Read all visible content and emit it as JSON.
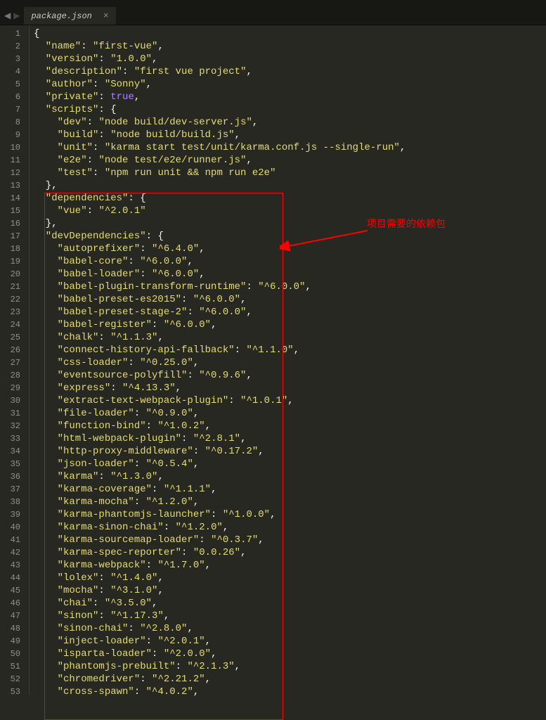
{
  "tab": {
    "name": "package.json",
    "close": "×"
  },
  "nav": {
    "left": "◀",
    "right": "▶"
  },
  "annotation": {
    "text": "项目需要的依赖包"
  },
  "code_lines": [
    [
      [
        "p",
        "{"
      ]
    ],
    [
      [
        "k",
        "  \"name\""
      ],
      [
        "p",
        ": "
      ],
      [
        "s",
        "\"first-vue\""
      ],
      [
        "p",
        ","
      ]
    ],
    [
      [
        "k",
        "  \"version\""
      ],
      [
        "p",
        ": "
      ],
      [
        "s",
        "\"1.0.0\""
      ],
      [
        "p",
        ","
      ]
    ],
    [
      [
        "k",
        "  \"description\""
      ],
      [
        "p",
        ": "
      ],
      [
        "s",
        "\"first vue project\""
      ],
      [
        "p",
        ","
      ]
    ],
    [
      [
        "k",
        "  \"author\""
      ],
      [
        "p",
        ": "
      ],
      [
        "s",
        "\"Sonny\""
      ],
      [
        "p",
        ","
      ]
    ],
    [
      [
        "k",
        "  \"private\""
      ],
      [
        "p",
        ": "
      ],
      [
        "kw",
        "true"
      ],
      [
        "p",
        ","
      ]
    ],
    [
      [
        "k",
        "  \"scripts\""
      ],
      [
        "p",
        ": {"
      ]
    ],
    [
      [
        "k",
        "    \"dev\""
      ],
      [
        "p",
        ": "
      ],
      [
        "s",
        "\"node build/dev-server.js\""
      ],
      [
        "p",
        ","
      ]
    ],
    [
      [
        "k",
        "    \"build\""
      ],
      [
        "p",
        ": "
      ],
      [
        "s",
        "\"node build/build.js\""
      ],
      [
        "p",
        ","
      ]
    ],
    [
      [
        "k",
        "    \"unit\""
      ],
      [
        "p",
        ": "
      ],
      [
        "s",
        "\"karma start test/unit/karma.conf.js --single-run\""
      ],
      [
        "p",
        ","
      ]
    ],
    [
      [
        "k",
        "    \"e2e\""
      ],
      [
        "p",
        ": "
      ],
      [
        "s",
        "\"node test/e2e/runner.js\""
      ],
      [
        "p",
        ","
      ]
    ],
    [
      [
        "k",
        "    \"test\""
      ],
      [
        "p",
        ": "
      ],
      [
        "s",
        "\"npm run unit && npm run e2e\""
      ]
    ],
    [
      [
        "p",
        "  },"
      ]
    ],
    [
      [
        "k",
        "  \"dependencies\""
      ],
      [
        "p",
        ": {"
      ]
    ],
    [
      [
        "k",
        "    \"vue\""
      ],
      [
        "p",
        ": "
      ],
      [
        "s",
        "\"^2.0.1\""
      ]
    ],
    [
      [
        "p",
        "  },"
      ]
    ],
    [
      [
        "k",
        "  \"devDependencies\""
      ],
      [
        "p",
        ": {"
      ]
    ],
    [
      [
        "k",
        "    \"autoprefixer\""
      ],
      [
        "p",
        ": "
      ],
      [
        "s",
        "\"^6.4.0\""
      ],
      [
        "p",
        ","
      ]
    ],
    [
      [
        "k",
        "    \"babel-core\""
      ],
      [
        "p",
        ": "
      ],
      [
        "s",
        "\"^6.0.0\""
      ],
      [
        "p",
        ","
      ]
    ],
    [
      [
        "k",
        "    \"babel-loader\""
      ],
      [
        "p",
        ": "
      ],
      [
        "s",
        "\"^6.0.0\""
      ],
      [
        "p",
        ","
      ]
    ],
    [
      [
        "k",
        "    \"babel-plugin-transform-runtime\""
      ],
      [
        "p",
        ": "
      ],
      [
        "s",
        "\"^6.0.0\""
      ],
      [
        "p",
        ","
      ]
    ],
    [
      [
        "k",
        "    \"babel-preset-es2015\""
      ],
      [
        "p",
        ": "
      ],
      [
        "s",
        "\"^6.0.0\""
      ],
      [
        "p",
        ","
      ]
    ],
    [
      [
        "k",
        "    \"babel-preset-stage-2\""
      ],
      [
        "p",
        ": "
      ],
      [
        "s",
        "\"^6.0.0\""
      ],
      [
        "p",
        ","
      ]
    ],
    [
      [
        "k",
        "    \"babel-register\""
      ],
      [
        "p",
        ": "
      ],
      [
        "s",
        "\"^6.0.0\""
      ],
      [
        "p",
        ","
      ]
    ],
    [
      [
        "k",
        "    \"chalk\""
      ],
      [
        "p",
        ": "
      ],
      [
        "s",
        "\"^1.1.3\""
      ],
      [
        "p",
        ","
      ]
    ],
    [
      [
        "k",
        "    \"connect-history-api-fallback\""
      ],
      [
        "p",
        ": "
      ],
      [
        "s",
        "\"^1.1.0\""
      ],
      [
        "p",
        ","
      ]
    ],
    [
      [
        "k",
        "    \"css-loader\""
      ],
      [
        "p",
        ": "
      ],
      [
        "s",
        "\"^0.25.0\""
      ],
      [
        "p",
        ","
      ]
    ],
    [
      [
        "k",
        "    \"eventsource-polyfill\""
      ],
      [
        "p",
        ": "
      ],
      [
        "s",
        "\"^0.9.6\""
      ],
      [
        "p",
        ","
      ]
    ],
    [
      [
        "k",
        "    \"express\""
      ],
      [
        "p",
        ": "
      ],
      [
        "s",
        "\"^4.13.3\""
      ],
      [
        "p",
        ","
      ]
    ],
    [
      [
        "k",
        "    \"extract-text-webpack-plugin\""
      ],
      [
        "p",
        ": "
      ],
      [
        "s",
        "\"^1.0.1\""
      ],
      [
        "p",
        ","
      ]
    ],
    [
      [
        "k",
        "    \"file-loader\""
      ],
      [
        "p",
        ": "
      ],
      [
        "s",
        "\"^0.9.0\""
      ],
      [
        "p",
        ","
      ]
    ],
    [
      [
        "k",
        "    \"function-bind\""
      ],
      [
        "p",
        ": "
      ],
      [
        "s",
        "\"^1.0.2\""
      ],
      [
        "p",
        ","
      ]
    ],
    [
      [
        "k",
        "    \"html-webpack-plugin\""
      ],
      [
        "p",
        ": "
      ],
      [
        "s",
        "\"^2.8.1\""
      ],
      [
        "p",
        ","
      ]
    ],
    [
      [
        "k",
        "    \"http-proxy-middleware\""
      ],
      [
        "p",
        ": "
      ],
      [
        "s",
        "\"^0.17.2\""
      ],
      [
        "p",
        ","
      ]
    ],
    [
      [
        "k",
        "    \"json-loader\""
      ],
      [
        "p",
        ": "
      ],
      [
        "s",
        "\"^0.5.4\""
      ],
      [
        "p",
        ","
      ]
    ],
    [
      [
        "k",
        "    \"karma\""
      ],
      [
        "p",
        ": "
      ],
      [
        "s",
        "\"^1.3.0\""
      ],
      [
        "p",
        ","
      ]
    ],
    [
      [
        "k",
        "    \"karma-coverage\""
      ],
      [
        "p",
        ": "
      ],
      [
        "s",
        "\"^1.1.1\""
      ],
      [
        "p",
        ","
      ]
    ],
    [
      [
        "k",
        "    \"karma-mocha\""
      ],
      [
        "p",
        ": "
      ],
      [
        "s",
        "\"^1.2.0\""
      ],
      [
        "p",
        ","
      ]
    ],
    [
      [
        "k",
        "    \"karma-phantomjs-launcher\""
      ],
      [
        "p",
        ": "
      ],
      [
        "s",
        "\"^1.0.0\""
      ],
      [
        "p",
        ","
      ]
    ],
    [
      [
        "k",
        "    \"karma-sinon-chai\""
      ],
      [
        "p",
        ": "
      ],
      [
        "s",
        "\"^1.2.0\""
      ],
      [
        "p",
        ","
      ]
    ],
    [
      [
        "k",
        "    \"karma-sourcemap-loader\""
      ],
      [
        "p",
        ": "
      ],
      [
        "s",
        "\"^0.3.7\""
      ],
      [
        "p",
        ","
      ]
    ],
    [
      [
        "k",
        "    \"karma-spec-reporter\""
      ],
      [
        "p",
        ": "
      ],
      [
        "s",
        "\"0.0.26\""
      ],
      [
        "p",
        ","
      ]
    ],
    [
      [
        "k",
        "    \"karma-webpack\""
      ],
      [
        "p",
        ": "
      ],
      [
        "s",
        "\"^1.7.0\""
      ],
      [
        "p",
        ","
      ]
    ],
    [
      [
        "k",
        "    \"lolex\""
      ],
      [
        "p",
        ": "
      ],
      [
        "s",
        "\"^1.4.0\""
      ],
      [
        "p",
        ","
      ]
    ],
    [
      [
        "k",
        "    \"mocha\""
      ],
      [
        "p",
        ": "
      ],
      [
        "s",
        "\"^3.1.0\""
      ],
      [
        "p",
        ","
      ]
    ],
    [
      [
        "k",
        "    \"chai\""
      ],
      [
        "p",
        ": "
      ],
      [
        "s",
        "\"^3.5.0\""
      ],
      [
        "p",
        ","
      ]
    ],
    [
      [
        "k",
        "    \"sinon\""
      ],
      [
        "p",
        ": "
      ],
      [
        "s",
        "\"^1.17.3\""
      ],
      [
        "p",
        ","
      ]
    ],
    [
      [
        "k",
        "    \"sinon-chai\""
      ],
      [
        "p",
        ": "
      ],
      [
        "s",
        "\"^2.8.0\""
      ],
      [
        "p",
        ","
      ]
    ],
    [
      [
        "k",
        "    \"inject-loader\""
      ],
      [
        "p",
        ": "
      ],
      [
        "s",
        "\"^2.0.1\""
      ],
      [
        "p",
        ","
      ]
    ],
    [
      [
        "k",
        "    \"isparta-loader\""
      ],
      [
        "p",
        ": "
      ],
      [
        "s",
        "\"^2.0.0\""
      ],
      [
        "p",
        ","
      ]
    ],
    [
      [
        "k",
        "    \"phantomjs-prebuilt\""
      ],
      [
        "p",
        ": "
      ],
      [
        "s",
        "\"^2.1.3\""
      ],
      [
        "p",
        ","
      ]
    ],
    [
      [
        "k",
        "    \"chromedriver\""
      ],
      [
        "p",
        ": "
      ],
      [
        "s",
        "\"^2.21.2\""
      ],
      [
        "p",
        ","
      ]
    ],
    [
      [
        "k",
        "    \"cross-spawn\""
      ],
      [
        "p",
        ": "
      ],
      [
        "s",
        "\"^4.0.2\""
      ],
      [
        "p",
        ","
      ]
    ]
  ]
}
